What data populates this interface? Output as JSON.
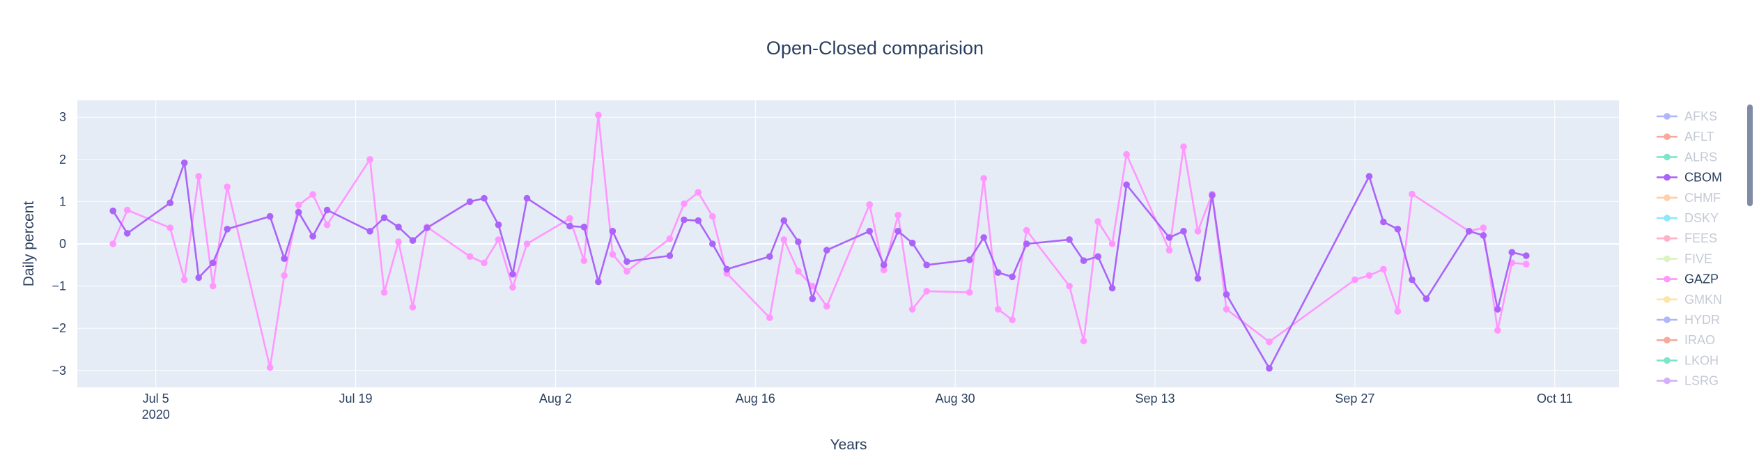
{
  "chart_data": {
    "type": "line",
    "title": "Open-Closed comparision",
    "xlabel": "Years",
    "ylabel": "Daily percent",
    "x_ticks": [
      {
        "date": "2020-07-05",
        "label": "Jul 5",
        "sublabel": "2020"
      },
      {
        "date": "2020-07-19",
        "label": "Jul 19"
      },
      {
        "date": "2020-08-02",
        "label": "Aug 2"
      },
      {
        "date": "2020-08-16",
        "label": "Aug 16"
      },
      {
        "date": "2020-08-30",
        "label": "Aug 30"
      },
      {
        "date": "2020-09-13",
        "label": "Sep 13"
      },
      {
        "date": "2020-09-27",
        "label": "Sep 27"
      },
      {
        "date": "2020-10-11",
        "label": "Oct 11"
      }
    ],
    "x_range": [
      "2020-06-29 12:00",
      "2020-10-15 12:00"
    ],
    "ylim": [
      -3.4,
      3.4
    ],
    "y_ticks": [
      3,
      2,
      1,
      0,
      -1,
      -2,
      -3
    ],
    "grid": true,
    "legend_position": "right",
    "colors": {
      "plot_bg": "#E5ECF6",
      "grid": "#ffffff",
      "text": "#2a3f5f",
      "legend_inactive_text": "#8a95ab",
      "scrollbar": "#808BA4"
    },
    "legend": [
      {
        "name": "AFKS",
        "color": "#636EFA",
        "visible": false
      },
      {
        "name": "AFLT",
        "color": "#EF553B",
        "visible": false
      },
      {
        "name": "ALRS",
        "color": "#00CC96",
        "visible": false
      },
      {
        "name": "CBOM",
        "color": "#AB63FA",
        "visible": true
      },
      {
        "name": "CHMF",
        "color": "#FFA15A",
        "visible": false
      },
      {
        "name": "DSKY",
        "color": "#19D3F3",
        "visible": false
      },
      {
        "name": "FEES",
        "color": "#FF6692",
        "visible": false
      },
      {
        "name": "FIVE",
        "color": "#B6E880",
        "visible": false
      },
      {
        "name": "GAZP",
        "color": "#FF97FF",
        "visible": true
      },
      {
        "name": "GMKN",
        "color": "#FECB52",
        "visible": false
      },
      {
        "name": "HYDR",
        "color": "#636EFA",
        "visible": false
      },
      {
        "name": "IRAO",
        "color": "#EF553B",
        "visible": false
      },
      {
        "name": "LKOH",
        "color": "#00CC96",
        "visible": false
      },
      {
        "name": "LSRG",
        "color": "#AB63FA",
        "visible": false
      }
    ],
    "series": [
      {
        "name": "CBOM",
        "color": "#AB63FA",
        "points": [
          [
            "2020-07-02",
            0.78
          ],
          [
            "2020-07-03",
            0.25
          ],
          [
            "2020-07-06",
            0.97
          ],
          [
            "2020-07-07",
            1.92
          ],
          [
            "2020-07-08",
            -0.8
          ],
          [
            "2020-07-09",
            -0.45
          ],
          [
            "2020-07-10",
            0.35
          ],
          [
            "2020-07-13",
            0.65
          ],
          [
            "2020-07-14",
            -0.35
          ],
          [
            "2020-07-15",
            0.75
          ],
          [
            "2020-07-16",
            0.18
          ],
          [
            "2020-07-17",
            0.8
          ],
          [
            "2020-07-20",
            0.3
          ],
          [
            "2020-07-21",
            0.62
          ],
          [
            "2020-07-22",
            0.4
          ],
          [
            "2020-07-23",
            0.08
          ],
          [
            "2020-07-24",
            0.38
          ],
          [
            "2020-07-27",
            1.0
          ],
          [
            "2020-07-28",
            1.08
          ],
          [
            "2020-07-29",
            0.45
          ],
          [
            "2020-07-30",
            -0.72
          ],
          [
            "2020-07-31",
            1.08
          ],
          [
            "2020-08-03",
            0.42
          ],
          [
            "2020-08-04",
            0.4
          ],
          [
            "2020-08-05",
            -0.9
          ],
          [
            "2020-08-06",
            0.3
          ],
          [
            "2020-08-07",
            -0.42
          ],
          [
            "2020-08-10",
            -0.28
          ],
          [
            "2020-08-11",
            0.57
          ],
          [
            "2020-08-12",
            0.55
          ],
          [
            "2020-08-13",
            0.0
          ],
          [
            "2020-08-14",
            -0.6
          ],
          [
            "2020-08-17",
            -0.3
          ],
          [
            "2020-08-18",
            0.55
          ],
          [
            "2020-08-19",
            0.05
          ],
          [
            "2020-08-20",
            -1.3
          ],
          [
            "2020-08-21",
            -0.15
          ],
          [
            "2020-08-24",
            0.3
          ],
          [
            "2020-08-25",
            -0.5
          ],
          [
            "2020-08-26",
            0.3
          ],
          [
            "2020-08-27",
            0.02
          ],
          [
            "2020-08-28",
            -0.5
          ],
          [
            "2020-08-31",
            -0.38
          ],
          [
            "2020-09-01",
            0.15
          ],
          [
            "2020-09-02",
            -0.68
          ],
          [
            "2020-09-03",
            -0.78
          ],
          [
            "2020-09-04",
            0.0
          ],
          [
            "2020-09-07",
            0.1
          ],
          [
            "2020-09-08",
            -0.4
          ],
          [
            "2020-09-09",
            -0.3
          ],
          [
            "2020-09-10",
            -1.05
          ],
          [
            "2020-09-11",
            1.4
          ],
          [
            "2020-09-14",
            0.15
          ],
          [
            "2020-09-15",
            0.3
          ],
          [
            "2020-09-16",
            -0.82
          ],
          [
            "2020-09-17",
            1.15
          ],
          [
            "2020-09-18",
            -1.2
          ],
          [
            "2020-09-21",
            -2.95
          ],
          [
            "2020-09-28",
            1.6
          ],
          [
            "2020-09-29",
            0.52
          ],
          [
            "2020-09-30",
            0.35
          ],
          [
            "2020-10-01",
            -0.85
          ],
          [
            "2020-10-02",
            -1.3
          ],
          [
            "2020-10-05",
            0.3
          ],
          [
            "2020-10-06",
            0.2
          ],
          [
            "2020-10-07",
            -1.55
          ],
          [
            "2020-10-08",
            -0.2
          ],
          [
            "2020-10-09",
            -0.28
          ]
        ]
      },
      {
        "name": "GAZP",
        "color": "#FF97FF",
        "points": [
          [
            "2020-07-02",
            0.0
          ],
          [
            "2020-07-03",
            0.8
          ],
          [
            "2020-07-06",
            0.38
          ],
          [
            "2020-07-07",
            -0.85
          ],
          [
            "2020-07-08",
            1.6
          ],
          [
            "2020-07-09",
            -1.0
          ],
          [
            "2020-07-10",
            1.35
          ],
          [
            "2020-07-13",
            -2.93
          ],
          [
            "2020-07-14",
            -0.75
          ],
          [
            "2020-07-15",
            0.92
          ],
          [
            "2020-07-16",
            1.17
          ],
          [
            "2020-07-17",
            0.45
          ],
          [
            "2020-07-20",
            2.0
          ],
          [
            "2020-07-21",
            -1.15
          ],
          [
            "2020-07-22",
            0.05
          ],
          [
            "2020-07-23",
            -1.5
          ],
          [
            "2020-07-24",
            0.4
          ],
          [
            "2020-07-27",
            -0.3
          ],
          [
            "2020-07-28",
            -0.45
          ],
          [
            "2020-07-29",
            0.1
          ],
          [
            "2020-07-30",
            -1.03
          ],
          [
            "2020-07-31",
            0.0
          ],
          [
            "2020-08-03",
            0.6
          ],
          [
            "2020-08-04",
            -0.4
          ],
          [
            "2020-08-05",
            3.05
          ],
          [
            "2020-08-06",
            -0.25
          ],
          [
            "2020-08-07",
            -0.65
          ],
          [
            "2020-08-10",
            0.12
          ],
          [
            "2020-08-11",
            0.95
          ],
          [
            "2020-08-12",
            1.22
          ],
          [
            "2020-08-13",
            0.65
          ],
          [
            "2020-08-14",
            -0.7
          ],
          [
            "2020-08-17",
            -1.75
          ],
          [
            "2020-08-18",
            0.1
          ],
          [
            "2020-08-19",
            -0.65
          ],
          [
            "2020-08-20",
            -1.0
          ],
          [
            "2020-08-21",
            -1.48
          ],
          [
            "2020-08-24",
            0.93
          ],
          [
            "2020-08-25",
            -0.62
          ],
          [
            "2020-08-26",
            0.68
          ],
          [
            "2020-08-27",
            -1.55
          ],
          [
            "2020-08-28",
            -1.12
          ],
          [
            "2020-08-31",
            -1.15
          ],
          [
            "2020-09-01",
            1.55
          ],
          [
            "2020-09-02",
            -1.55
          ],
          [
            "2020-09-03",
            -1.8
          ],
          [
            "2020-09-04",
            0.32
          ],
          [
            "2020-09-07",
            -1.0
          ],
          [
            "2020-09-08",
            -2.3
          ],
          [
            "2020-09-09",
            0.53
          ],
          [
            "2020-09-10",
            0.0
          ],
          [
            "2020-09-11",
            2.12
          ],
          [
            "2020-09-14",
            -0.15
          ],
          [
            "2020-09-15",
            2.3
          ],
          [
            "2020-09-16",
            0.3
          ],
          [
            "2020-09-17",
            1.18
          ],
          [
            "2020-09-18",
            -1.55
          ],
          [
            "2020-09-21",
            -2.32
          ],
          [
            "2020-09-27",
            -0.85
          ],
          [
            "2020-09-28",
            -0.75
          ],
          [
            "2020-09-29",
            -0.6
          ],
          [
            "2020-09-30",
            -1.6
          ],
          [
            "2020-10-01",
            1.18
          ],
          [
            "2020-10-05",
            0.3
          ],
          [
            "2020-10-06",
            0.38
          ],
          [
            "2020-10-07",
            -2.05
          ],
          [
            "2020-10-08",
            -0.45
          ],
          [
            "2020-10-09",
            -0.48
          ]
        ]
      }
    ]
  }
}
